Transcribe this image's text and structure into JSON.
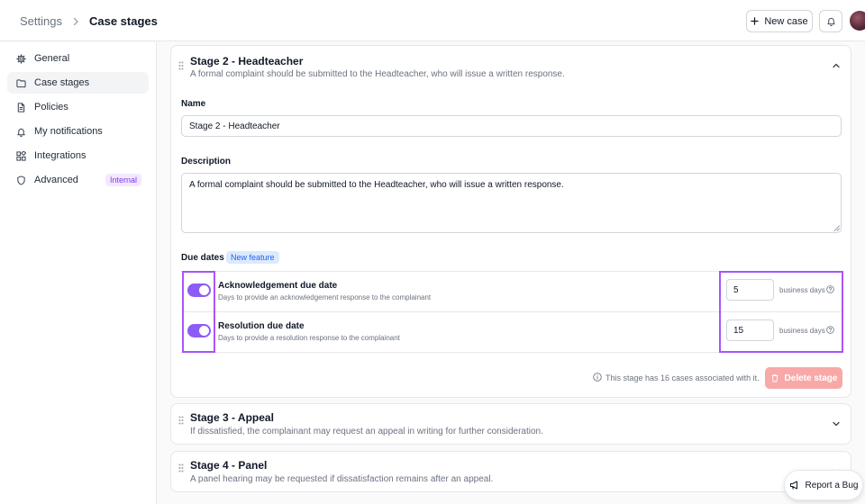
{
  "header": {
    "breadcrumb_parent": "Settings",
    "breadcrumb_current": "Case stages",
    "new_case_label": "New case"
  },
  "sidebar": {
    "items": [
      {
        "label": "General",
        "icon": "gear-icon"
      },
      {
        "label": "Case stages",
        "icon": "folder-icon",
        "active": true
      },
      {
        "label": "Policies",
        "icon": "document-icon"
      },
      {
        "label": "My notifications",
        "icon": "bell-icon"
      },
      {
        "label": "Integrations",
        "icon": "integrations-icon"
      },
      {
        "label": "Advanced",
        "icon": "shield-icon",
        "badge": "Internal"
      }
    ]
  },
  "stages": {
    "expanded": {
      "title": "Stage 2 - Headteacher",
      "description": "A formal complaint should be submitted to the Headteacher, who will issue a written response.",
      "name_label": "Name",
      "name_value": "Stage 2 - Headteacher",
      "description_label": "Description",
      "description_value": "A formal complaint should be submitted to the Headteacher, who will issue a written response.",
      "due_dates_label": "Due dates",
      "new_feature_badge": "New feature",
      "due_dates": [
        {
          "title": "Acknowledgement due date",
          "subtitle": "Days to provide an acknowledgement response to the complainant",
          "enabled": true,
          "days": "5",
          "unit": "business days"
        },
        {
          "title": "Resolution due date",
          "subtitle": "Days to provide a resolution response to the complainant",
          "enabled": true,
          "days": "15",
          "unit": "business days"
        }
      ],
      "cases_info": "This stage has 16 cases associated with it.",
      "delete_label": "Delete stage"
    },
    "stage3": {
      "title": "Stage 3 - Appeal",
      "description": "If dissatisfied, the complainant may request an appeal in writing for further consideration."
    },
    "stage4": {
      "title": "Stage 4 - Panel",
      "description": "A panel hearing may be requested if dissatisfaction remains after an appeal."
    }
  },
  "report_bug_label": "Report a Bug",
  "colors": {
    "accent": "#8b5cf6",
    "highlight": "#a855f7",
    "danger_disabled": "#f9a8a8",
    "badge_new_bg": "#dbeafe",
    "badge_internal_bg": "#f3e8ff"
  }
}
